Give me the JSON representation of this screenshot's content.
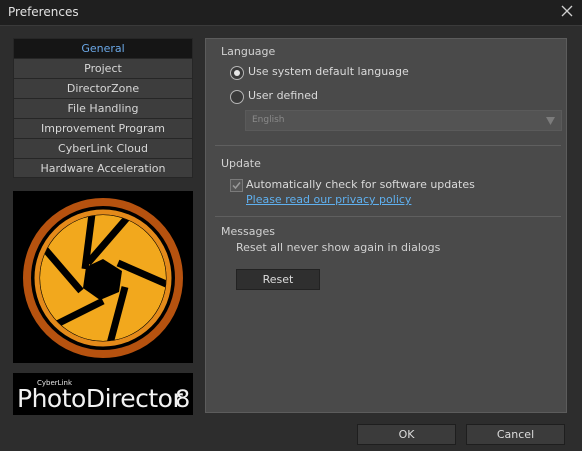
{
  "window": {
    "title": "Preferences"
  },
  "nav": {
    "items": [
      {
        "label": "General",
        "active": true
      },
      {
        "label": "Project"
      },
      {
        "label": "DirectorZone"
      },
      {
        "label": "File Handling"
      },
      {
        "label": "Improvement Program"
      },
      {
        "label": "CyberLink Cloud"
      },
      {
        "label": "Hardware Acceleration"
      }
    ]
  },
  "brand": {
    "small": "CyberLink",
    "name": "PhotoDirector",
    "version": "8"
  },
  "language": {
    "heading": "Language",
    "option_default": "Use system default language",
    "option_user": "User defined",
    "selected_option": "default",
    "select_value": "English"
  },
  "update": {
    "heading": "Update",
    "auto_check_label": "Automatically check for software updates",
    "auto_check": true,
    "privacy_link": "Please read our privacy policy"
  },
  "messages": {
    "heading": "Messages",
    "description": "Reset all never show again in dialogs",
    "reset_label": "Reset"
  },
  "footer": {
    "ok_label": "OK",
    "cancel_label": "Cancel"
  },
  "colors": {
    "accent": "#6aa7e6",
    "link": "#5fb0ef",
    "logo_orange": "#f0a51c",
    "logo_dark_orange": "#c45e12"
  }
}
